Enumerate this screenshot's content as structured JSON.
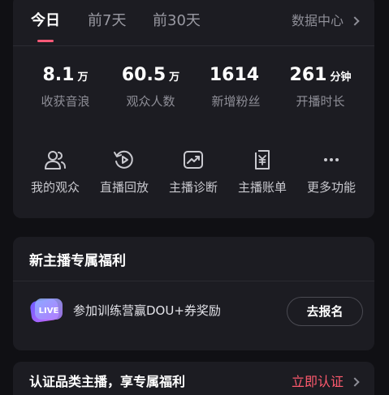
{
  "tabs": [
    {
      "label": "今日",
      "active": true
    },
    {
      "label": "前7天",
      "active": false
    },
    {
      "label": "前30天",
      "active": false
    }
  ],
  "data_center": "数据中心",
  "stats": [
    {
      "value": "8.1",
      "unit": "万",
      "label": "收获音浪"
    },
    {
      "value": "60.5",
      "unit": "万",
      "label": "观众人数"
    },
    {
      "value": "1614",
      "unit": "",
      "label": "新增粉丝"
    },
    {
      "value": "261",
      "unit": "分钟",
      "label": "开播时长"
    }
  ],
  "tools": [
    {
      "label": "我的观众",
      "icon": "audience-icon"
    },
    {
      "label": "直播回放",
      "icon": "replay-icon"
    },
    {
      "label": "主播诊断",
      "icon": "diagnosis-icon"
    },
    {
      "label": "主播账单",
      "icon": "bill-icon"
    },
    {
      "label": "更多功能",
      "icon": "more-icon"
    }
  ],
  "welfare": {
    "title": "新主播专属福利",
    "badge_text": "LIVE",
    "desc": "参加训练营赢DOU+券奖励",
    "button": "去报名"
  },
  "cert": {
    "title": "认证品类主播，享专属福利",
    "link": "立即认证"
  },
  "colors": {
    "background": "#101014",
    "card": "#1c1c22",
    "accent": "#ff5a78",
    "link": "#ff5a6e",
    "muted": "#8e8e97"
  }
}
